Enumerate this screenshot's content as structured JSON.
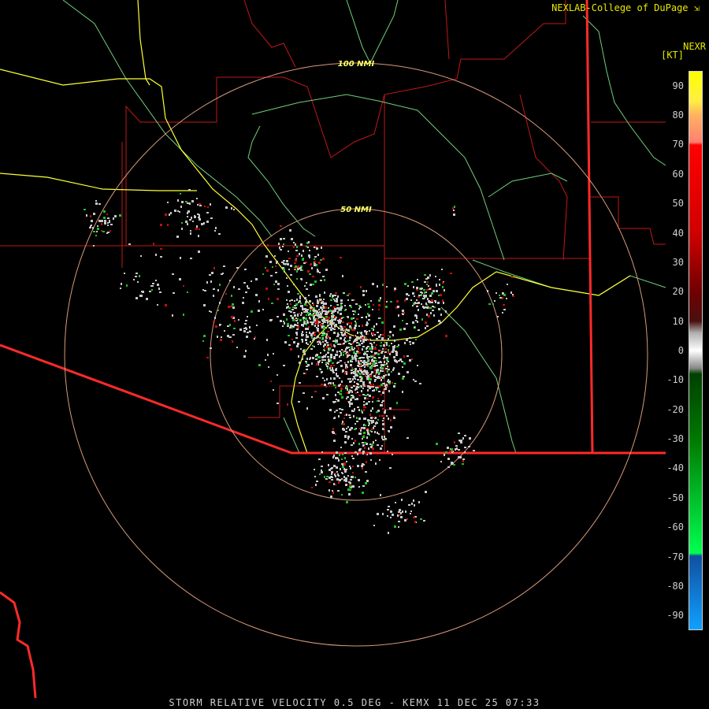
{
  "header": {
    "credit": "NEXLAB-College of DuPage",
    "credit_icon": "arrow-corner-icon",
    "product_code": "NEXR",
    "unit": "[KT]"
  },
  "footer": {
    "caption": "STORM RELATIVE VELOCITY 0.5 DEG - KEMX 11 DEC 25 07:33"
  },
  "range_rings": {
    "inner_label": "50 NMI",
    "outer_label": "100 NMI",
    "color": "#d89a7a"
  },
  "colors": {
    "background": "#000000",
    "state_border": "#ff2a2a",
    "county_lines": "#c01818",
    "highways": "#ffff33",
    "rivers": "#6fd07a",
    "clutter": "#c8c8c8",
    "inbound": "#20c020",
    "outbound": "#c01010"
  },
  "legend": {
    "labels": [
      "90",
      "80",
      "70",
      "60",
      "50",
      "40",
      "30",
      "20",
      "10",
      "0",
      "-10",
      "-20",
      "-30",
      "-40",
      "-50",
      "-60",
      "-70",
      "-80",
      "-90"
    ],
    "min": -95,
    "max": 95,
    "stops": [
      {
        "value": 95,
        "color": "#ffff00"
      },
      {
        "value": 85,
        "color": "#ffee44"
      },
      {
        "value": 80,
        "color": "#ffb060"
      },
      {
        "value": 71,
        "color": "#ff8070"
      },
      {
        "value": 70,
        "color": "#ff0000"
      },
      {
        "value": 40,
        "color": "#d00000"
      },
      {
        "value": 20,
        "color": "#700000"
      },
      {
        "value": 10,
        "color": "#4a1010"
      },
      {
        "value": 6,
        "color": "#b0b0b0"
      },
      {
        "value": 0,
        "color": "#ffffff"
      },
      {
        "value": -6,
        "color": "#888888"
      },
      {
        "value": -8,
        "color": "#004000"
      },
      {
        "value": -30,
        "color": "#007800"
      },
      {
        "value": -69,
        "color": "#00ff50"
      },
      {
        "value": -70,
        "color": "#1050a0"
      },
      {
        "value": -95,
        "color": "#10a0ff"
      }
    ]
  }
}
